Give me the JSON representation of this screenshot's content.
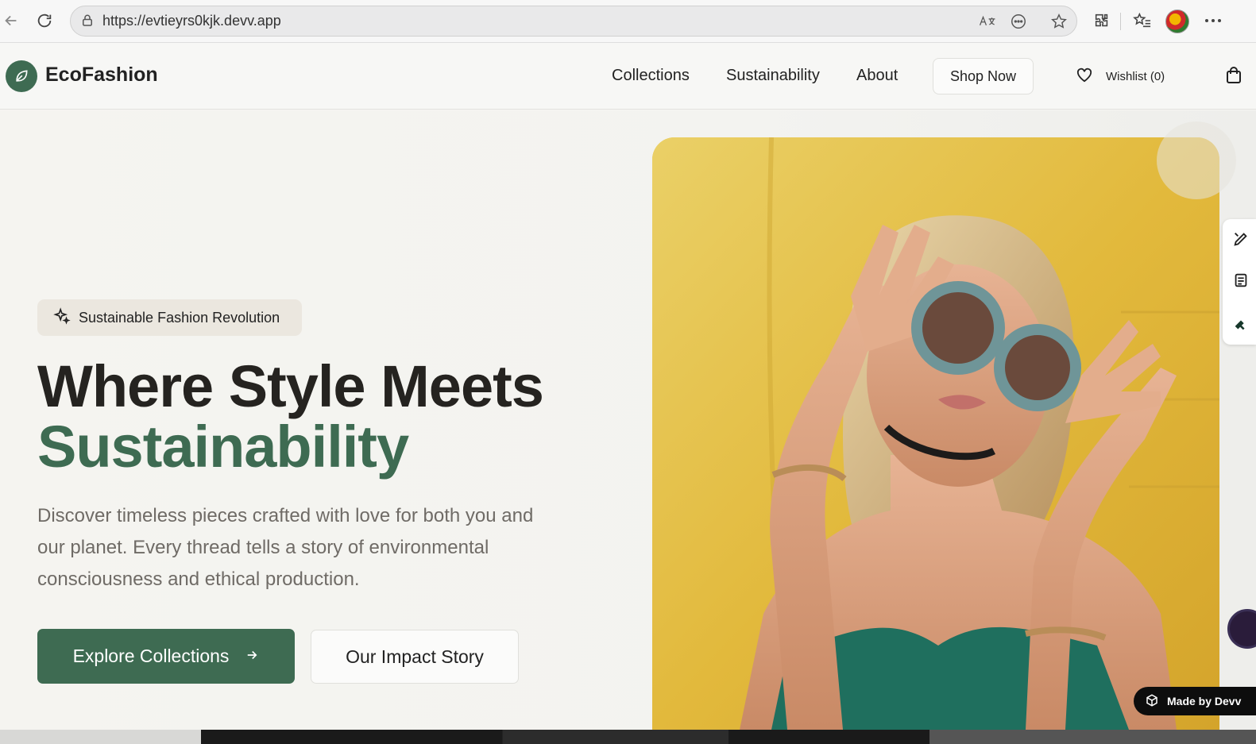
{
  "browser": {
    "url": "https://evtieyrs0kjk.devv.app"
  },
  "header": {
    "brand": "EcoFashion",
    "nav": [
      "Collections",
      "Sustainability",
      "About"
    ],
    "shop_label": "Shop Now",
    "wishlist_label": "Wishlist (0)"
  },
  "hero": {
    "badge": "Sustainable Fashion Revolution",
    "title_line1": "Where Style Meets",
    "title_line2": "Sustainability",
    "description": "Discover timeless pieces crafted with love for both you and our planet. Every thread tells a story of environmental consciousness and ethical production.",
    "primary_cta": "Explore Collections",
    "secondary_cta": "Our Impact Story"
  },
  "footer_badge": {
    "label": "Made by Devv"
  },
  "colors": {
    "brand_green": "#3e6b52",
    "headline": "#252320",
    "badge_bg": "#ebe7df",
    "photo_bg": "#e3bb3e"
  },
  "icons": {
    "back": "arrow-left-icon",
    "reload": "reload-icon",
    "lock": "lock-icon",
    "translate": "translate-icon",
    "more_page": "more-circle-icon",
    "favorite": "star-icon",
    "extensions": "puzzle-icon",
    "favorites": "favorites-list-icon",
    "menu": "ellipsis-icon",
    "leaf": "leaf-icon",
    "heart": "heart-icon",
    "bag": "shopping-bag-icon",
    "sparkle": "sparkle-icon",
    "arrow": "arrow-right-icon",
    "cube": "cube-icon"
  }
}
